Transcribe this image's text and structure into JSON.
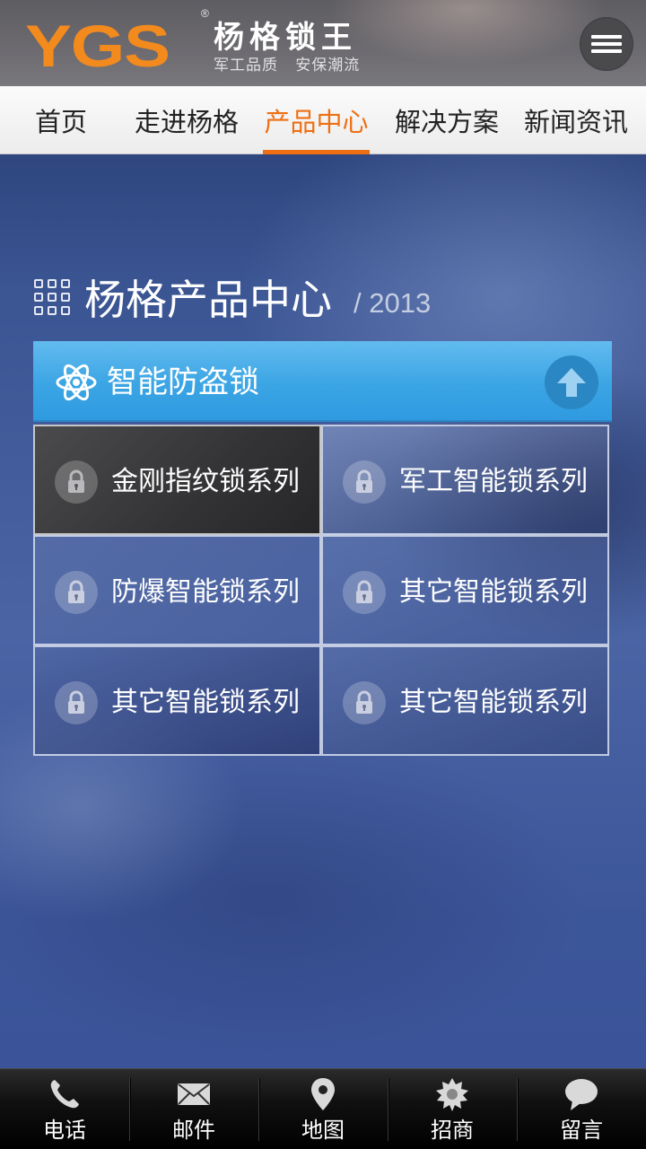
{
  "header": {
    "logo_text": "YGS",
    "logo_mark": "®",
    "brand_name": "杨格锁王",
    "slogan": "军工品质   安保潮流",
    "menu_icon": "hamburger-menu-icon"
  },
  "nav": {
    "items": [
      {
        "label": "首页",
        "active": false
      },
      {
        "label": "走进杨格",
        "active": false
      },
      {
        "label": "产品中心",
        "active": true
      },
      {
        "label": "解决方案",
        "active": false
      },
      {
        "label": "新闻资讯",
        "active": false
      }
    ],
    "active_color": "#ee6f13"
  },
  "section": {
    "title": "杨格产品中心",
    "year": "/ 2013",
    "title_icon": "grid-icon"
  },
  "category": {
    "icon": "atom-icon",
    "title": "智能防盗锁",
    "toggle_icon": "arrow-up-icon",
    "color": "#3ba5e4"
  },
  "products": [
    {
      "label": "金刚指纹锁系列",
      "icon": "lock-icon",
      "selected": true
    },
    {
      "label": "军工智能锁系列",
      "icon": "lock-icon",
      "selected": false
    },
    {
      "label": "防爆智能锁系列",
      "icon": "lock-icon",
      "selected": false
    },
    {
      "label": "其它智能锁系列",
      "icon": "lock-icon",
      "selected": false
    },
    {
      "label": "其它智能锁系列",
      "icon": "lock-icon",
      "selected": false
    },
    {
      "label": "其它智能锁系列",
      "icon": "lock-icon",
      "selected": false
    }
  ],
  "bottom_bar": {
    "tabs": [
      {
        "label": "电话",
        "icon": "phone-icon"
      },
      {
        "label": "邮件",
        "icon": "mail-icon"
      },
      {
        "label": "地图",
        "icon": "map-pin-icon"
      },
      {
        "label": "招商",
        "icon": "badge-icon"
      },
      {
        "label": "留言",
        "icon": "chat-bubble-icon"
      }
    ]
  }
}
